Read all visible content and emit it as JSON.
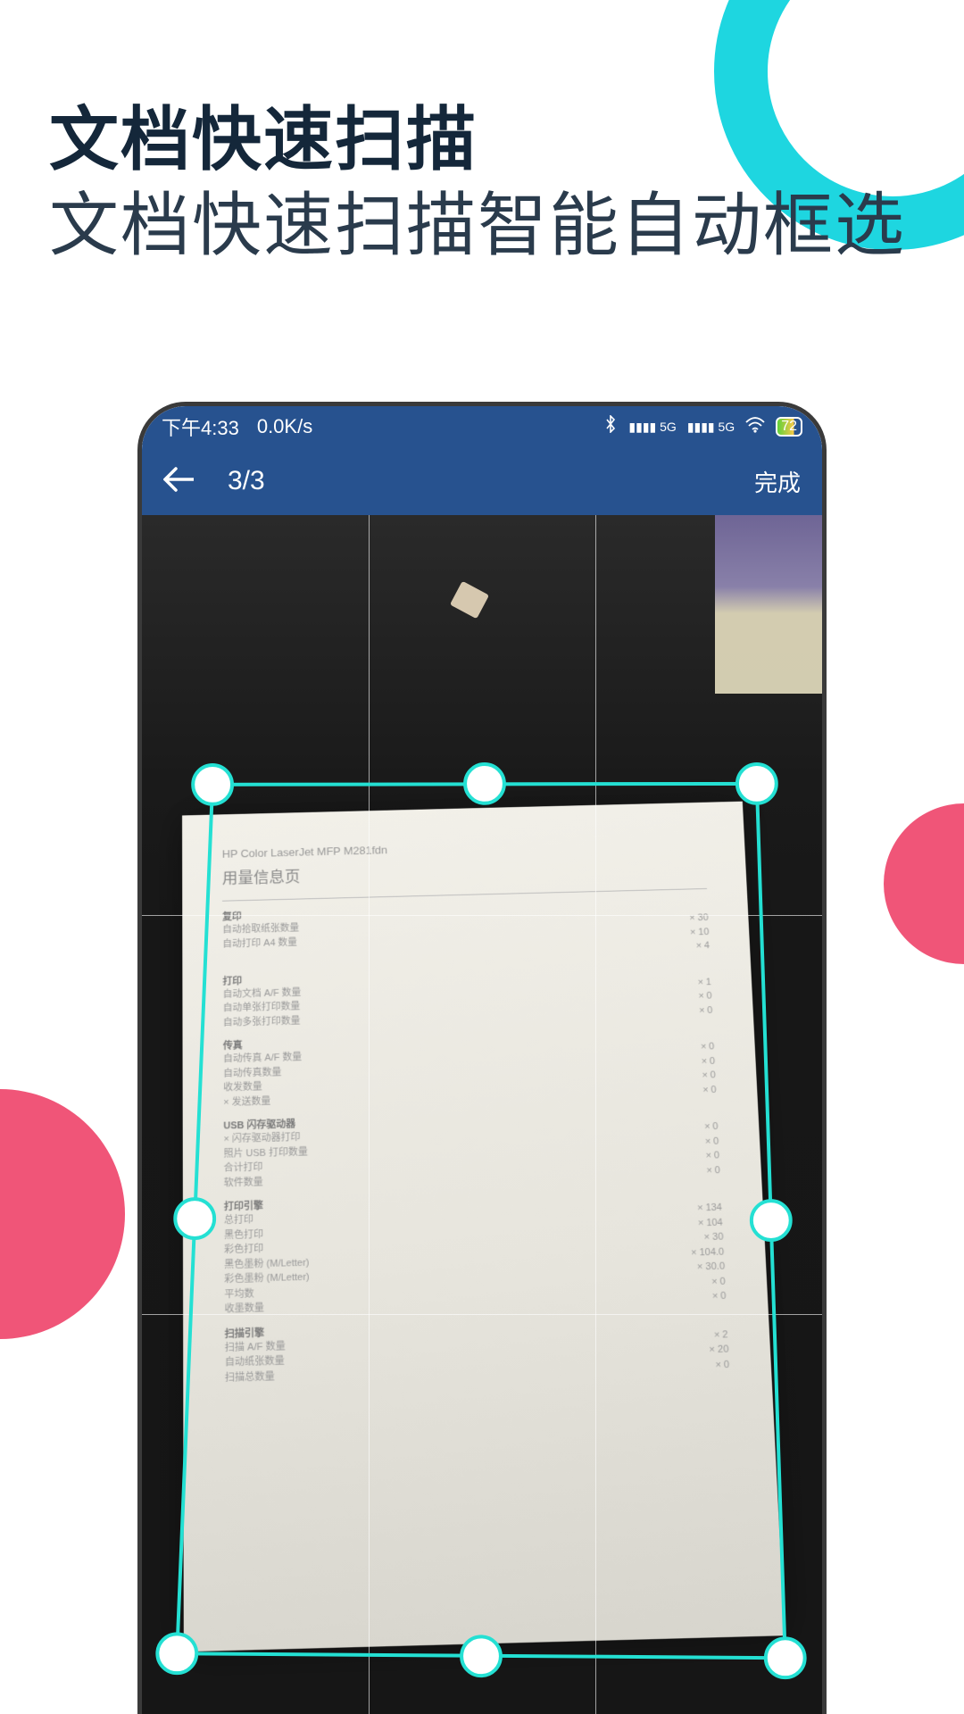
{
  "promo": {
    "title": "文档快速扫描",
    "subtitle": "文档快速扫描智能自动框选"
  },
  "status_bar": {
    "time": "下午4:33",
    "speed": "0.0K/s",
    "battery": "72"
  },
  "app_bar": {
    "counter": "3/3",
    "done": "完成"
  },
  "document": {
    "printer_model": "HP Color LaserJet MFP M281fdn",
    "page_title": "用量信息页"
  },
  "crop": {
    "handle_color": "#24e0d3"
  }
}
